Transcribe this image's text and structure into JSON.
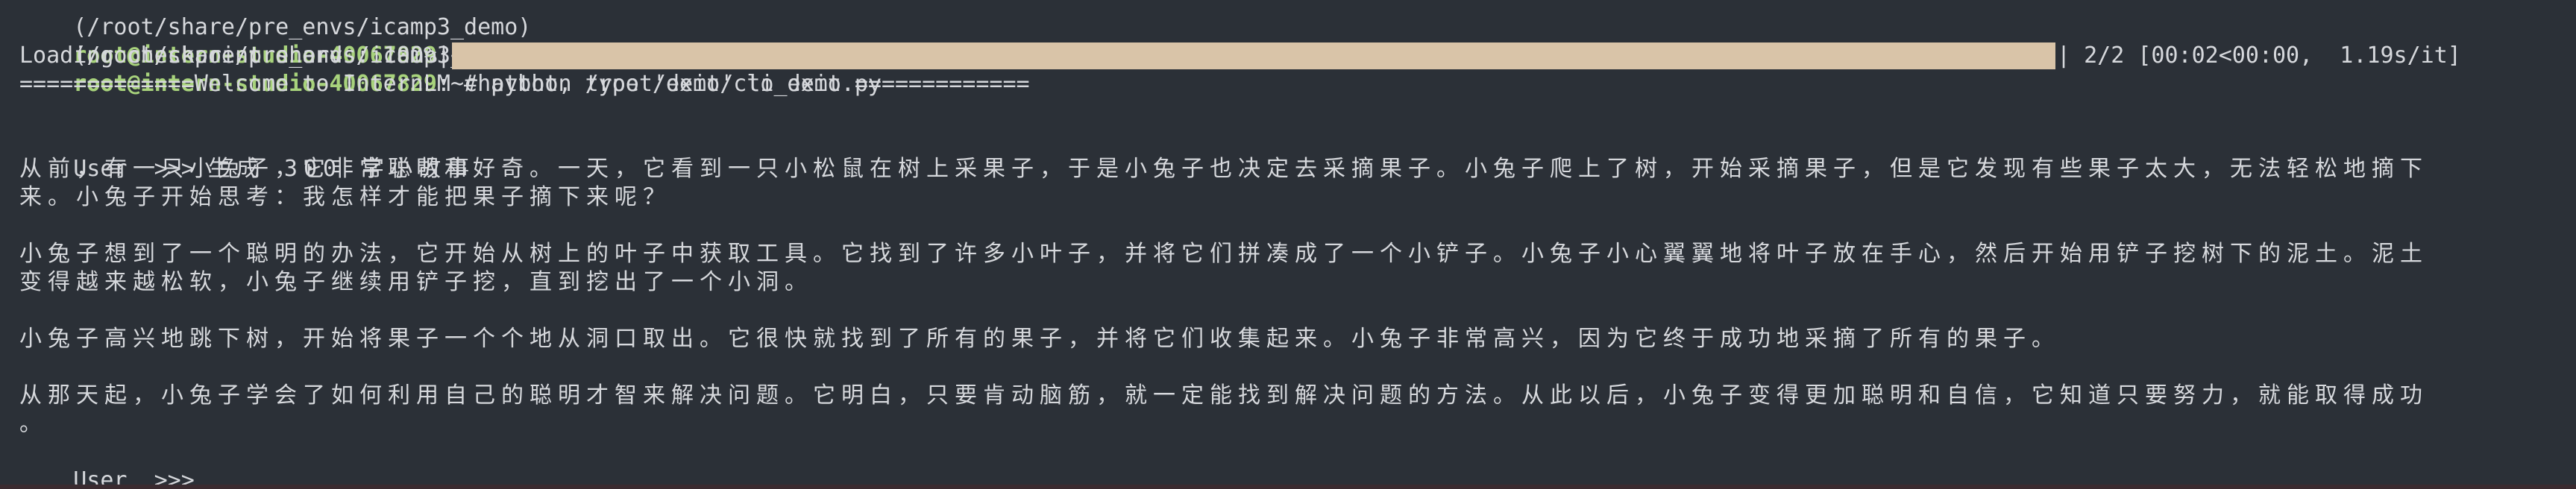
{
  "terminal": {
    "line0_env": "(/root/share/pre_envs/icamp3_demo)",
    "line0_user": "root@intern-studio-40067829",
    "line0_rest": ":~#",
    "line1_env": "(/root/share/pre_envs/icamp3_demo)",
    "line1_user": "root@intern-studio-40067829",
    "line1_sym": ":~#",
    "line1_cmd": " python /root/demo/cli_demo.py",
    "progress_label": "Loading checkpoint shards: 100%|",
    "progress_fraction": 1.0,
    "progress_tail": "| 2/2 [00:02<00:00,  1.19s/it]",
    "welcome": "=============Welcome to InternLM chatbot, type 'exit' to exit.=============",
    "user_prompt_1": "User  >>> ",
    "user_query_1": "生成 300 字小故事",
    "story_p1_a": "从前，有一只小兔子，它非常聪明和好奇。一天，它看到一只小松鼠在树上采果子，于是小兔子也决定去采摘果子。小兔子爬上了树，开始采摘果子，但是它发现有些果子太大，无法轻松地摘下",
    "story_p1_b": "来。小兔子开始思考：我怎样才能把果子摘下来呢？",
    "story_p2_a": "小兔子想到了一个聪明的办法，它开始从树上的叶子中获取工具。它找到了许多小叶子，并将它们拼凑成了一个小铲子。小兔子小心翼翼地将叶子放在手心，然后开始用铲子挖树下的泥土。泥土",
    "story_p2_b": "变得越来越松软，小兔子继续用铲子挖，直到挖出了一个小洞。",
    "story_p3": "小兔子高兴地跳下树，开始将果子一个个地从洞口取出。它很快就找到了所有的果子，并将它们收集起来。小兔子非常高兴，因为它终于成功地采摘了所有的果子。",
    "story_p4_a": "从那天起，小兔子学会了如何利用自己的聪明才智来解决问题。它明白，只要肯动脑筋，就一定能找到解决问题的方法。从此以后，小兔子变得更加聪明和自信，它知道只要努力，就能取得成功",
    "story_p4_b": "。",
    "user_prompt_2": "User  >>>"
  }
}
